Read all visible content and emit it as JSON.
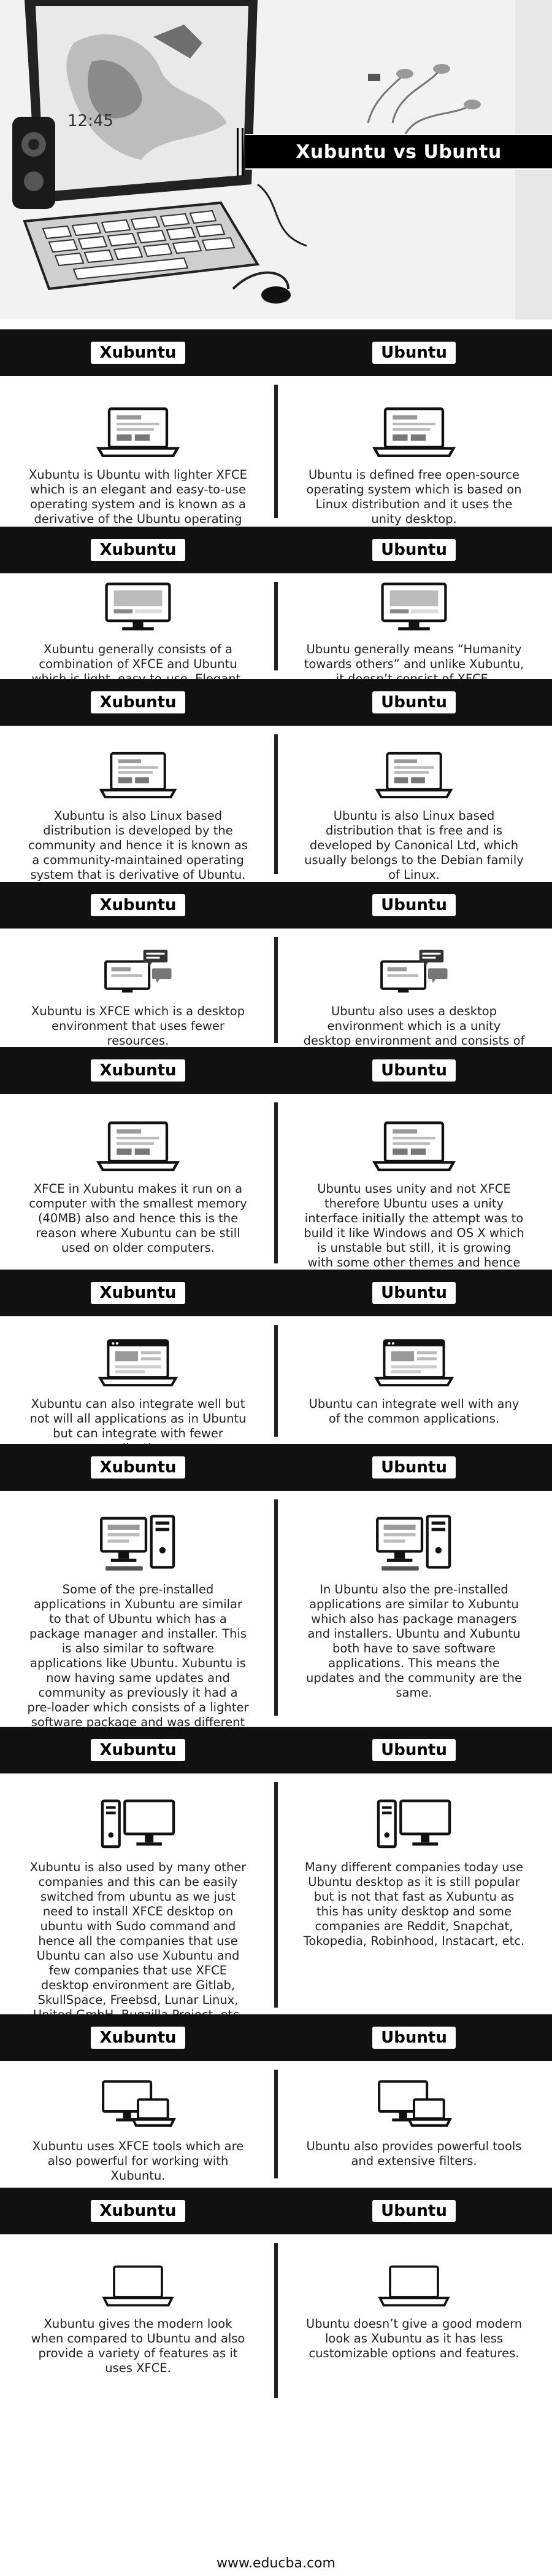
{
  "hero": {
    "title": "Xubuntu vs Ubuntu"
  },
  "labels": {
    "left": "Xubuntu",
    "right": "Ubuntu"
  },
  "rows": [
    {
      "icon": "laptop-icon",
      "left": "Xubuntu is Ubuntu with lighter XFCE which is an elegant and easy-to-use operating system and is known as a derivative of the Ubuntu operating system.",
      "right": "Ubuntu is defined free open-source operating system which is based on Linux distribution and it uses the unity desktop."
    },
    {
      "icon": "monitor-icon",
      "left": "Xubuntu generally consists of a combination of XFCE and Ubuntu which is light, easy-to-use. Elegant, stable, and configurable.",
      "right": "Ubuntu generally means “Humanity towards others” and unlike Xubuntu, it doesn’t consist of XFCE."
    },
    {
      "icon": "laptop-icon",
      "left": "Xubuntu is also Linux based distribution is developed by the community and hence it is known as a community-maintained operating system that is derivative of Ubuntu.",
      "right": "Ubuntu is also Linux based distribution that is free and is developed by Canonical Ltd, which usually belongs to the Debian family of Linux."
    },
    {
      "icon": "monitor-chat-icon",
      "left": "Xubuntu is XFCE which is a desktop environment that uses fewer resources.",
      "right": "Ubuntu also uses a desktop environment which is a unity desktop environment and consists of lesser options for customizations of desktop."
    },
    {
      "icon": "laptop-icon",
      "left": "XFCE in Xubuntu makes it run on a computer with the smallest memory (40MB) also and hence this is the reason where Xubuntu can be still used on older computers.",
      "right": "Ubuntu uses unity and not XFCE therefore Ubuntu uses a unity interface initially the attempt was to build it like Windows and OS X which is unstable but still, it is growing with some other themes and hence cannot be used on older computers that have low-end hardware."
    },
    {
      "icon": "browser-icon",
      "left": "Xubuntu can also integrate well but not will all applications as in Ubuntu but can integrate with fewer applications.",
      "right": "Ubuntu can integrate well with any of the common applications."
    },
    {
      "icon": "desktop-tower-icon",
      "left": "Some of the pre-installed applications in Xubuntu are similar to that of Ubuntu which has a package manager and installer. This is also similar to software applications like Ubuntu. Xubuntu is now having same updates and community as previously it had a pre-loader which consists of a lighter software package and was different from Ubuntu.",
      "right": "In Ubuntu also the pre-installed applications are similar to Xubuntu which also has package managers and installers. Ubuntu and Xubuntu both have to save software applications. This means the updates and the community are the same."
    },
    {
      "icon": "tower-monitor-icon",
      "left": "Xubuntu is also used by many other companies and this can be easily switched from ubuntu as we just need to install XFCE desktop on ubuntu with Sudo command and hence all the companies that use Ubuntu can also use Xubuntu and few companies that use XFCE desktop environment are Gitlab, SkullSpace, Freebsd, Lunar Linux, United GmbH, Bugzilla Project, etc.",
      "right": "Many different companies today use Ubuntu desktop as it is still popular but is not that fast as Xubuntu as this has unity desktop and some companies are Reddit, Snapchat, Tokopedia, Robinhood, Instacart, etc."
    },
    {
      "icon": "monitor-laptop-icon",
      "left": "Xubuntu uses XFCE tools which are also powerful for working with Xubuntu.",
      "right": "Ubuntu also provides powerful tools and extensive filters."
    },
    {
      "icon": "laptop-outline-icon",
      "left": "Xubuntu gives the modern look when compared to Ubuntu and also provide a variety of features as it uses XFCE.",
      "right": "Ubuntu doesn’t give a good modern look as Xubuntu as it has less customizable options and features."
    }
  ],
  "footer": {
    "site": "www.educba.com"
  },
  "colors": {
    "header_band": "#111111",
    "divider": "#222222",
    "text": "#222222"
  }
}
